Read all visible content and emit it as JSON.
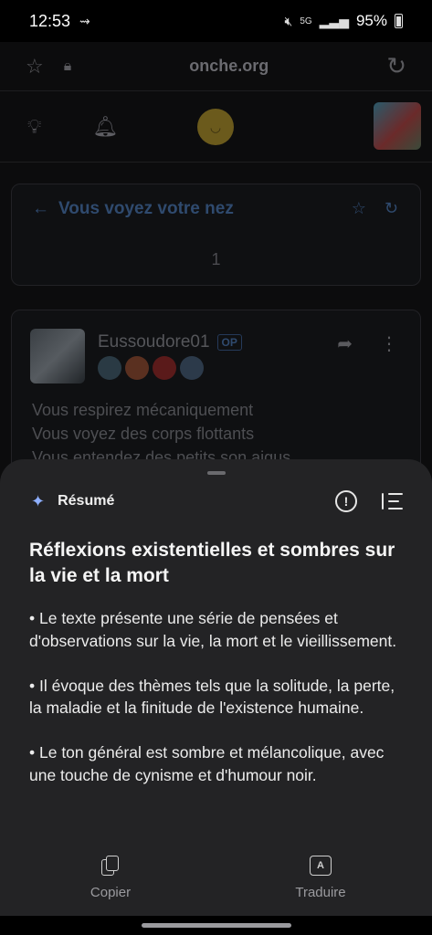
{
  "status_bar": {
    "time": "12:53",
    "battery": "95%",
    "network": "5G"
  },
  "browser": {
    "url": "onche.org"
  },
  "topic": {
    "title": "Vous voyez votre nez",
    "page": "1"
  },
  "post": {
    "author": "Eussoudore01",
    "badge": "OP",
    "lines": [
      "Vous respirez mécaniquement",
      "Vous voyez des corps flottants",
      "Vous entendez des petits son aigus"
    ]
  },
  "summary_sheet": {
    "label": "Résumé",
    "title": "Réflexions existentielles et sombres sur la vie et la mort",
    "bullets": [
      "• Le texte présente une série de pensées et d'observations sur la vie, la mort et le vieillissement.",
      "• Il évoque des thèmes tels que la solitude, la perte, la maladie et la finitude de l'existence humaine.",
      "• Le ton général est sombre et mélancolique, avec une touche de cynisme et d'humour noir."
    ],
    "copy_label": "Copier",
    "translate_label": "Traduire"
  },
  "colors": {
    "sheet_bg": "#232325",
    "accent": "#8fb0ff",
    "page_bg": "#0c0c0d"
  }
}
